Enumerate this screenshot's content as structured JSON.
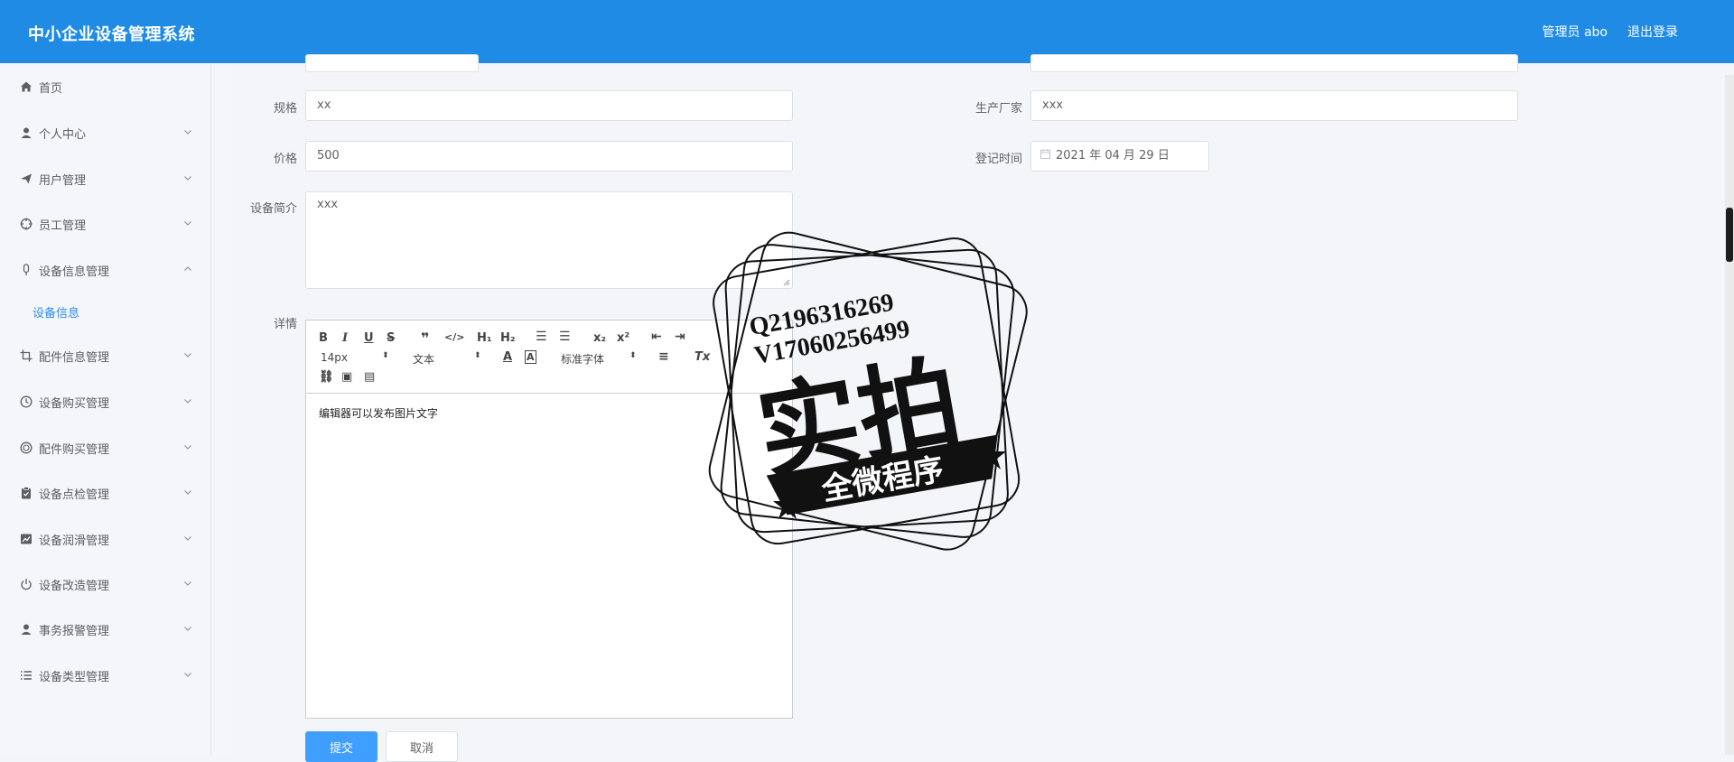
{
  "header": {
    "title": "中小企业设备管理系统",
    "user_label": "管理员 abo",
    "logout_label": "退出登录"
  },
  "sidebar": {
    "items": [
      {
        "label": "首页",
        "icon": "home-icon"
      },
      {
        "label": "个人中心",
        "icon": "user-icon"
      },
      {
        "label": "用户管理",
        "icon": "send-icon"
      },
      {
        "label": "员工管理",
        "icon": "aim-icon"
      },
      {
        "label": "设备信息管理",
        "icon": "mic-icon",
        "expanded": true
      },
      {
        "label": "配件信息管理",
        "icon": "crop-icon"
      },
      {
        "label": "设备购买管理",
        "icon": "time-icon"
      },
      {
        "label": "配件购买管理",
        "icon": "coin-icon"
      },
      {
        "label": "设备点检管理",
        "icon": "clipboard-icon"
      },
      {
        "label": "设备润滑管理",
        "icon": "chart-icon"
      },
      {
        "label": "设备改造管理",
        "icon": "power-icon"
      },
      {
        "label": "事务报警管理",
        "icon": "person-icon"
      },
      {
        "label": "设备类型管理",
        "icon": "list-icon"
      }
    ],
    "sub_item": "设备信息"
  },
  "form": {
    "spec_label": "规格",
    "spec_value": "xx",
    "manufacturer_label": "生产厂家",
    "manufacturer_value": "xxx",
    "price_label": "价格",
    "price_value": "500",
    "register_label": "登记时间",
    "register_value": "2021 年 04 月 29 日",
    "intro_label": "设备简介",
    "intro_value": "xxx",
    "detail_label": "详情"
  },
  "editor": {
    "font_size": "14px",
    "block_type": "文本",
    "font_family": "标准字体",
    "content": "编辑器可以发布图片文字"
  },
  "actions": {
    "submit_label": "提交",
    "cancel_label": "取消"
  },
  "watermark": {
    "line1": "Q2196316269",
    "line2": "V17060256499",
    "big": "实拍",
    "ribbon": "全微程序"
  },
  "colors": {
    "header": "#1f8be4",
    "primary": "#409eff",
    "active_sub": "#2d8cf0"
  }
}
